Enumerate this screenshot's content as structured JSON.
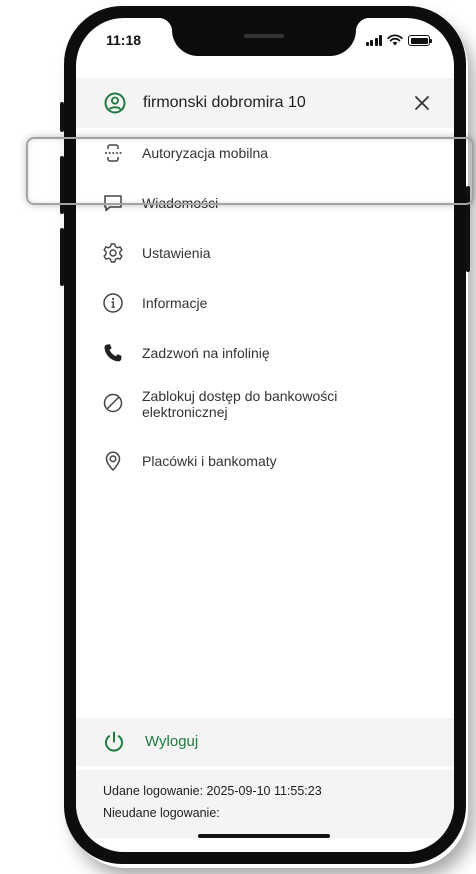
{
  "status": {
    "time": "11:18"
  },
  "header": {
    "account_name": "firmonski dobromira 10",
    "icon": "user-circle-icon",
    "close_icon": "close-icon"
  },
  "menu": {
    "items": [
      {
        "label": "Autoryzacja mobilna",
        "icon": "mobile-authorization-icon",
        "highlighted": true
      },
      {
        "label": "Wiadomości",
        "icon": "message-icon"
      },
      {
        "label": "Ustawienia",
        "icon": "gear-icon"
      },
      {
        "label": "Informacje",
        "icon": "info-icon"
      },
      {
        "label": "Zadzwoń na infolinię",
        "icon": "phone-icon"
      },
      {
        "label": "Zablokuj dostęp do bankowości elektronicznej",
        "icon": "block-icon"
      },
      {
        "label": "Placówki i bankomaty",
        "icon": "location-pin-icon"
      }
    ]
  },
  "logout": {
    "label": "Wyloguj",
    "icon": "power-icon"
  },
  "login_info": {
    "successful": "Udane logowanie: 2025-09-10 11:55:23",
    "failed": "Nieudane logowanie:"
  },
  "colors": {
    "accent": "#1e7a3e",
    "panel": "#f4f4f4",
    "text": "#333333"
  }
}
